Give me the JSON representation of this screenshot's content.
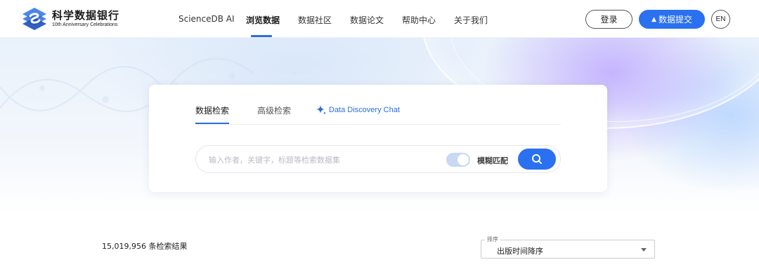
{
  "brand": {
    "title": "科学数据银行",
    "subtitle": "10th Anniversary Celebrations"
  },
  "nav": {
    "items": [
      {
        "label": "ScienceDB AI",
        "active": false
      },
      {
        "label": "浏览数据",
        "active": true
      },
      {
        "label": "数据社区",
        "active": false
      },
      {
        "label": "数据论文",
        "active": false
      },
      {
        "label": "帮助中心",
        "active": false
      },
      {
        "label": "关于我们",
        "active": false
      }
    ]
  },
  "header_actions": {
    "login_label": "登录",
    "submit_label": "数据提交",
    "lang_label": "EN"
  },
  "search": {
    "tabs": [
      {
        "label": "数据检索",
        "active": true
      },
      {
        "label": "高级检索",
        "active": false
      },
      {
        "label": "Data Discovery Chat",
        "active": false,
        "icon": "sparkle-icon"
      }
    ],
    "placeholder": "输入作者，关键字，标题等检索数据集",
    "value": "",
    "fuzzy_label": "模糊匹配",
    "fuzzy_on": true
  },
  "results": {
    "count_text": "15,019,956 条检索结果",
    "sort_legend": "排序",
    "sort_value": "出版时间降序"
  },
  "colors": {
    "accent": "#2a70f0",
    "toggle_track": "#c9d8f3"
  }
}
